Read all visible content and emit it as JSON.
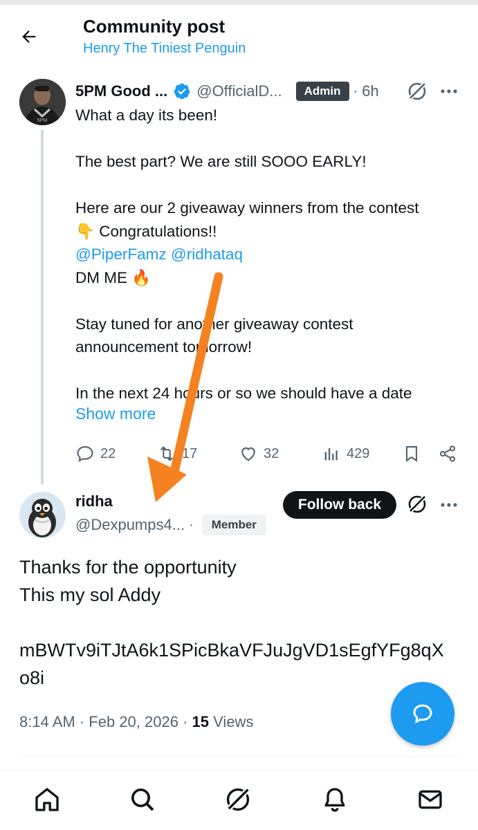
{
  "header": {
    "title": "Community post",
    "subtitle": "Henry The Tiniest Penguin"
  },
  "post1": {
    "name": "5PM Good ...",
    "handle": "@OfficialD...",
    "badge": "Admin",
    "separator": "·",
    "time": "6h",
    "lines": {
      "l1": "What a day its been!",
      "l3": "The best part? We are still SOOO EARLY!",
      "l5": "Here are our 2 giveaway winners from the contest",
      "l6": "Congratulations!!",
      "l6_emoji": "👇",
      "l7a": "@PiperFamz",
      "l7b": "@ridhataq",
      "l8": "DM ME",
      "l8_emoji": "🔥",
      "l10": "Stay tuned for another giveaway contest",
      "l11": "announcement tomorrow!",
      "l13": "In the next 24 hours or so we should have a date"
    },
    "show_more": "Show more",
    "actions": {
      "replies": "22",
      "reposts": "17",
      "likes": "32",
      "views": "429"
    }
  },
  "post2": {
    "name": "ridha",
    "handle": "@Dexpumps4...",
    "separator": "·",
    "badge": "Member",
    "follow_label": "Follow back",
    "lines": {
      "l1": "Thanks for the opportunity",
      "l2": "This my sol Addy",
      "l4": "mBWTv9iTJtA6k1SPicBkaVFJuJgVD1sEgfYFg8qX",
      "l5": "o8i"
    },
    "meta": {
      "time": "8:14 AM",
      "sep1": "·",
      "date": "Feb 20, 2026",
      "sep2": "·",
      "views_count": "15",
      "views_label": "Views"
    }
  },
  "colors": {
    "accent": "#1d9bf0",
    "text": "#0f1419",
    "muted": "#536471",
    "arrow": "#f58220"
  },
  "icons": {
    "back": "arrow-left-icon",
    "verified": "verified-badge-icon",
    "grok": "grok-icon",
    "more": "more-horizontal-icon",
    "reply": "reply-icon",
    "repost": "repost-icon",
    "like": "heart-icon",
    "views": "views-chart-icon",
    "bookmark": "bookmark-icon",
    "share": "share-icon",
    "compose": "compose-reply-icon",
    "nav": [
      "home-icon",
      "search-icon",
      "grok-icon",
      "notifications-icon",
      "messages-icon"
    ]
  }
}
